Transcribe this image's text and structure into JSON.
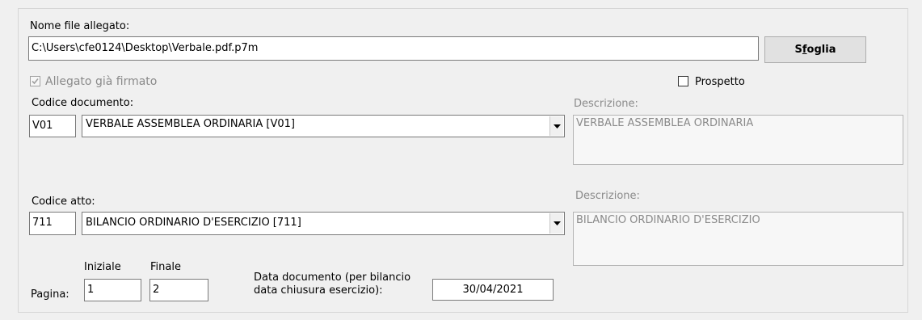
{
  "attachment": {
    "label": "Nome file allegato:",
    "file_path": "C:\\Users\\cfe0124\\Desktop\\Verbale.pdf.p7m",
    "browse_label_prefix": "S",
    "browse_label_mnemonic": "f",
    "browse_label_suffix": "oglia",
    "signed_label": "Allegato già firmato",
    "signed_checked": true,
    "prospetto_label": "Prospetto",
    "prospetto_checked": false
  },
  "document": {
    "code_label": "Codice documento:",
    "code": "V01",
    "selected": "VERBALE ASSEMBLEA ORDINARIA [V01]",
    "description_label": "Descrizione:",
    "description": "VERBALE ASSEMBLEA ORDINARIA"
  },
  "act": {
    "code_label": "Codice atto:",
    "code": "711",
    "selected": "BILANCIO ORDINARIO D'ESERCIZIO [711]",
    "description_label": "Descrizione:",
    "description": "BILANCIO ORDINARIO D'ESERCIZIO"
  },
  "pages": {
    "label": "Pagina:",
    "start_label": "Iniziale",
    "end_label": "Finale",
    "start": "1",
    "end": "2"
  },
  "doc_date": {
    "label_line1": "Data documento (per bilancio",
    "label_line2": "data chiusura esercizio):",
    "value": "30/04/2021"
  },
  "colors": {
    "background": "#f0f0f0",
    "disabled_text": "#8a8a8a",
    "border": "#7a7a7a"
  }
}
